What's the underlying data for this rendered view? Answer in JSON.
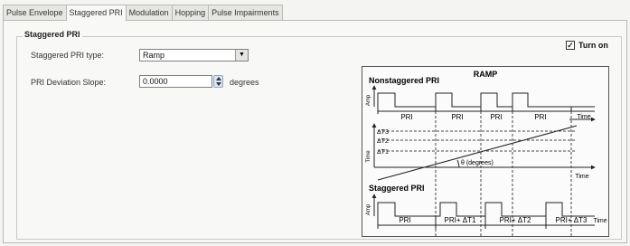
{
  "tabs": [
    {
      "label": "Pulse Envelope"
    },
    {
      "label": "Staggered PRI"
    },
    {
      "label": "Modulation"
    },
    {
      "label": "Hopping"
    },
    {
      "label": "Pulse Impairments"
    }
  ],
  "active_tab": "Staggered PRI",
  "group_title": "Staggered PRI",
  "turn_on": {
    "label": "Turn on",
    "checked": true,
    "mark": "✓"
  },
  "pri_type": {
    "label": "Staggered PRI type:",
    "value": "Ramp"
  },
  "deviation_slope": {
    "label": "PRI Deviation Slope:",
    "value": "0.0000",
    "unit": "degrees"
  },
  "diagram": {
    "title": "RAMP",
    "nonstaggered_title": "Nonstaggered PRI",
    "staggered_title": "Staggered PRI",
    "amp_label": "Amp",
    "time_axis_label": "Time",
    "pri_labels": [
      "PRI",
      "PRI",
      "PRI",
      "PRI"
    ],
    "stag_labels": [
      "PRI",
      "PRI+ ΔT1",
      "PRI+ ΔT2",
      "PRI+ ΔT3"
    ],
    "delta_labels": [
      "ΔT3",
      "ΔT2",
      "ΔT1"
    ],
    "angle_label": "θ (degrees)"
  }
}
